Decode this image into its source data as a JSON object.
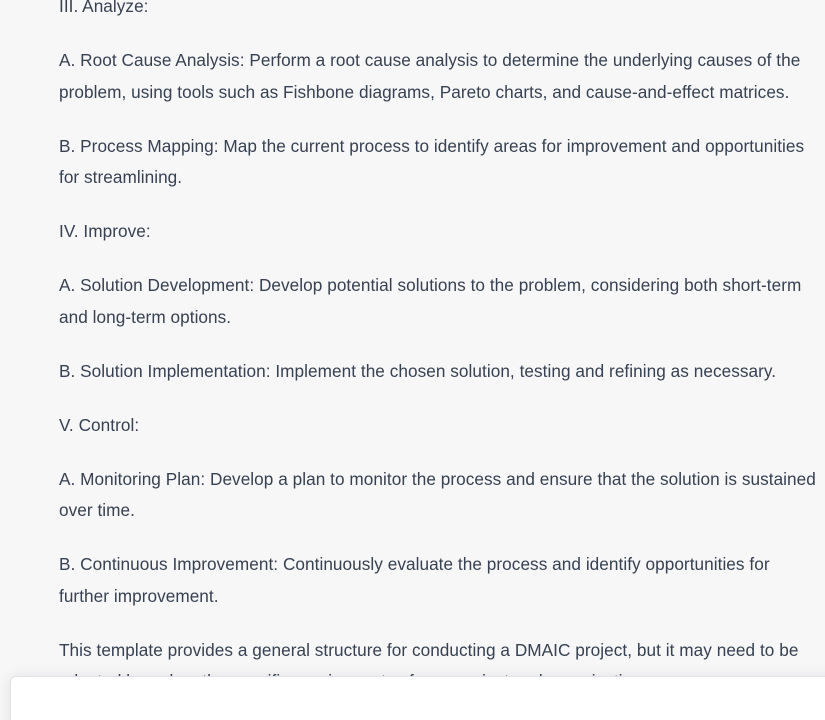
{
  "conversation": {
    "paragraphs": [
      "III. Analyze:",
      "A. Root Cause Analysis: Perform a root cause analysis to determine the underlying causes of the problem, using tools such as Fishbone diagrams, Pareto charts, and cause-and-effect matrices.",
      "B. Process Mapping: Map the current process to identify areas for improvement and opportunities for streamlining.",
      "IV. Improve:",
      "A. Solution Development: Develop potential solutions to the problem, considering both short-term and long-term options.",
      "B. Solution Implementation: Implement the chosen solution, testing and refining as necessary.",
      "V. Control:",
      "A. Monitoring Plan: Develop a plan to monitor the process and ensure that the solution is sustained over time.",
      "B. Continuous Improvement: Continuously evaluate the process and identify opportunities for further improvement.",
      "This template provides a general structure for conducting a DMAIC project, but it may need to be adapted based on the specific requirements of your project and organization."
    ]
  },
  "colors": {
    "background": "#f7f7f8",
    "text": "#374151",
    "composer_bg": "#ffffff"
  }
}
